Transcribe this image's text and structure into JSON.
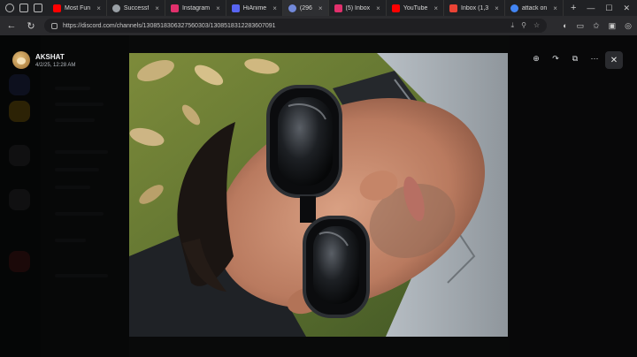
{
  "browser": {
    "tabs": [
      {
        "label": "Most Fun",
        "color": "#ff0000"
      },
      {
        "label": "Successf",
        "color": "#9aa0a6"
      },
      {
        "label": "Instagram",
        "color": "#e1306c"
      },
      {
        "label": "HiAnime",
        "color": "#5865f2"
      },
      {
        "label": "(296",
        "color": "#7289da"
      },
      {
        "label": "(5) Inbox",
        "color": "#e1306c"
      },
      {
        "label": "YouTube",
        "color": "#ff0000"
      },
      {
        "label": "Inbox (1,3",
        "color": "#ea4335"
      },
      {
        "label": "attack on",
        "color": "#4285f4"
      }
    ],
    "url": "https://discord.com/channels/1308518306327560303/1308518312283607091"
  },
  "viewer": {
    "author_name": "AKSHAT",
    "timestamp": "4/2/25, 12:28 AM"
  }
}
